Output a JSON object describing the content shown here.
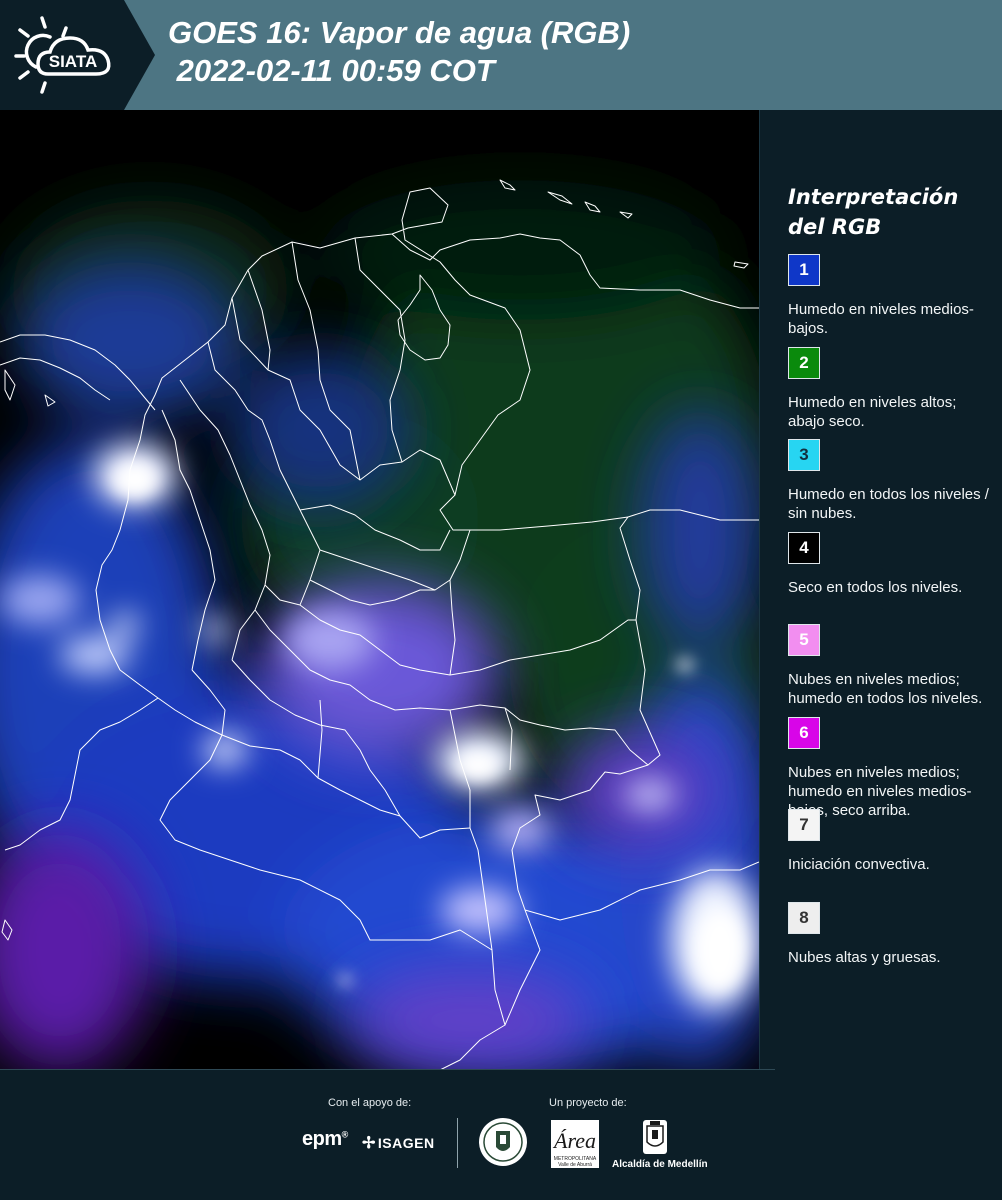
{
  "header": {
    "logo_text": "SIATA",
    "title_line1": "GOES 16: Vapor de agua (RGB)",
    "title_line2": " 2022-02-11 00:59 COT",
    "background_color": "#4d7583",
    "logo_background": "#0c1e27"
  },
  "map": {
    "type": "satellite-rgb-composite",
    "region": "Colombia",
    "boundaries": "white"
  },
  "legend": {
    "title": "Interpretación del RGB",
    "items": [
      {
        "number": "1",
        "color": "#0f37c8",
        "text_color": "#ffffff",
        "description": "Humedo en niveles medios-bajos."
      },
      {
        "number": "2",
        "color": "#0a8a0c",
        "text_color": "#ffffff",
        "description": "Humedo en niveles altos; abajo seco."
      },
      {
        "number": "3",
        "color": "#27d5f2",
        "text_color": "#123040",
        "description": "Humedo en todos los niveles / sin nubes."
      },
      {
        "number": "4",
        "color": "#000000",
        "text_color": "#ffffff",
        "description": "Seco en todos los niveles."
      },
      {
        "number": "5",
        "color": "#f28ef0",
        "text_color": "#ffffff",
        "description": "Nubes en niveles medios; humedo en todos los niveles."
      },
      {
        "number": "6",
        "color": "#d805e8",
        "text_color": "#ffffff",
        "description": "Nubes en niveles medios; humedo en niveles medios-bajos, seco arriba."
      },
      {
        "number": "7",
        "color": "#f4f4f4",
        "text_color": "#333333",
        "description": "Iniciación convectiva."
      },
      {
        "number": "8",
        "color": "#eeeeee",
        "text_color": "#333333",
        "description": "Nubes altas y gruesas."
      }
    ]
  },
  "footer": {
    "support_label": "Con el apoyo de:",
    "project_label": "Un proyecto de:",
    "epm": "epm",
    "epm_mark": "®",
    "isagen": "ISAGEN",
    "area_metropolitana": "Área",
    "area_subtitle": "METROPOLITANA Valle de Aburrá",
    "alcaldia": "Alcaldía de Medellín"
  }
}
